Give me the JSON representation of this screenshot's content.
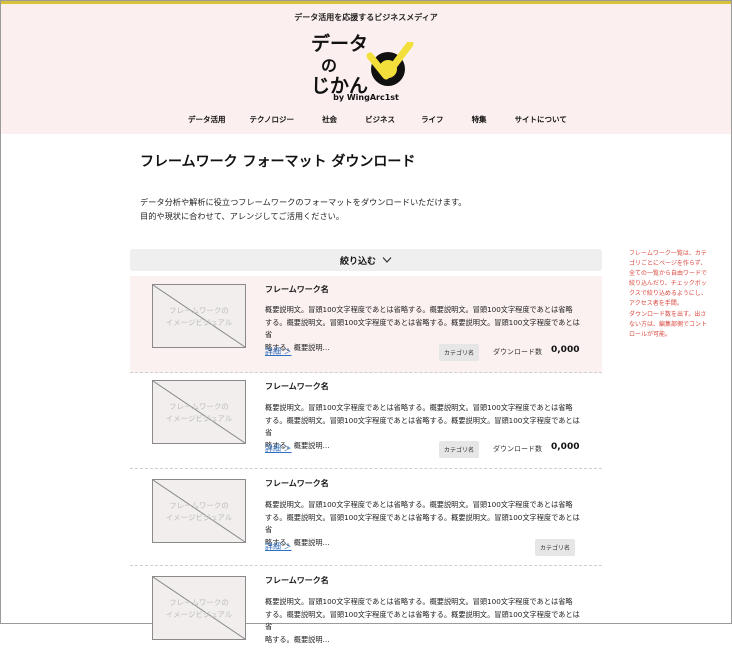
{
  "header": {
    "tagline": "データ活用を応援するビジネスメディア",
    "logo_line1": "データ",
    "logo_line2": "の",
    "logo_line3": "じかん",
    "by": "by  WingArc1st",
    "colors": {
      "header_bg": "#fbf0ef",
      "logo_yellow": "#f3df3c",
      "accent_line": "#d8c23a"
    }
  },
  "nav": [
    "データ活用",
    "テクノロジー",
    "社会",
    "ビジネス",
    "ライフ",
    "特集",
    "サイトについて"
  ],
  "page": {
    "title": "フレームワーク フォーマット ダウンロード",
    "desc_line1": "データ分析や解析に役立つフレームワークのフォーマットをダウンロードいただけます。",
    "desc_line2": "目的や現状に合わせて、アレンジしてご活用ください。"
  },
  "filter": {
    "label": "絞り込む",
    "icon": "chevron-down-icon"
  },
  "notes": {
    "note1": "フレームワーク一覧は、カテゴリごとにページを作らず、全ての一覧から自由ワードで絞り込んだり、チェックボックスで絞り込めるようにし、アクセス者を手間。",
    "note2": "ダウンロード数を出す。出さない方は、編集部側でコントロールが可能。"
  },
  "items": [
    {
      "title": "フレームワーク名",
      "thumb_line1": "フレームワークの",
      "thumb_line2": "イメージビジュアル",
      "desc_line1": "概要説明文。冒頭100文字程度であとは省略する。概要説明文。冒頭100文字程度であとは省略",
      "desc_line2": "する。概要説明文。冒頭100文字程度であとは省略する。概要説明文。冒頭100文字程度であとは省",
      "desc_line3": "略する。概要説明…",
      "detail": "詳細 ＞",
      "category": "カテゴリ名",
      "downloads_label": "ダウンロード数",
      "downloads": "0,000"
    },
    {
      "title": "フレームワーク名",
      "thumb_line1": "フレームワークの",
      "thumb_line2": "イメージビジュアル",
      "desc_line1": "概要説明文。冒頭100文字程度であとは省略する。概要説明文。冒頭100文字程度であとは省略",
      "desc_line2": "する。概要説明文。冒頭100文字程度であとは省略する。概要説明文。冒頭100文字程度であとは省",
      "desc_line3": "略する。概要説明…",
      "detail": "詳細 ＞",
      "category": "カテゴリ名",
      "downloads_label": "ダウンロード数",
      "downloads": "0,000"
    },
    {
      "title": "フレームワーク名",
      "thumb_line1": "フレームワークの",
      "thumb_line2": "イメージビジュアル",
      "desc_line1": "概要説明文。冒頭100文字程度であとは省略する。概要説明文。冒頭100文字程度であとは省略",
      "desc_line2": "する。概要説明文。冒頭100文字程度であとは省略する。概要説明文。冒頭100文字程度であとは省",
      "desc_line3": "略する。概要説明…",
      "detail": "詳細 ＞",
      "category": "カテゴリ名"
    },
    {
      "title": "フレームワーク名",
      "thumb_line1": "フレームワークの",
      "thumb_line2": "イメージビジュアル",
      "desc_line1": "概要説明文。冒頭100文字程度であとは省略する。概要説明文。冒頭100文字程度であとは省略",
      "desc_line2": "する。概要説明文。冒頭100文字程度であとは省略する。概要説明文。冒頭100文字程度であとは省",
      "desc_line3": "略する。概要説明…"
    }
  ]
}
